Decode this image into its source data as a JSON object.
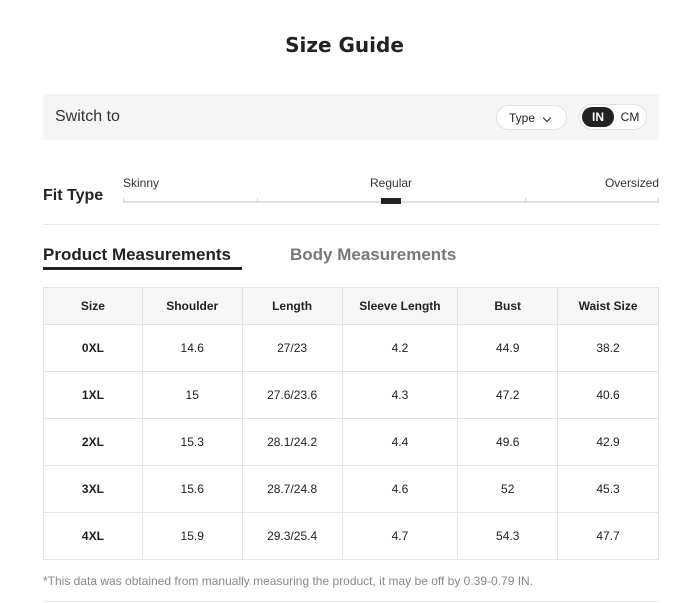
{
  "title": "Size Guide",
  "switch_bar": {
    "label": "Switch to",
    "type_dropdown": "Type",
    "units": {
      "in": "IN",
      "cm": "CM",
      "selected": "IN"
    }
  },
  "fit_type": {
    "label": "Fit Type",
    "options": [
      "Skinny",
      "Regular",
      "Oversized"
    ],
    "selected": "Regular"
  },
  "tabs": {
    "product": "Product Measurements",
    "body": "Body Measurements",
    "active": "Product Measurements"
  },
  "table": {
    "headers": [
      "Size",
      "Shoulder",
      "Length",
      "Sleeve Length",
      "Bust",
      "Waist Size"
    ],
    "rows": [
      [
        "0XL",
        "14.6",
        "27/23",
        "4.2",
        "44.9",
        "38.2"
      ],
      [
        "1XL",
        "15",
        "27.6/23.6",
        "4.3",
        "47.2",
        "40.6"
      ],
      [
        "2XL",
        "15.3",
        "28.1/24.2",
        "4.4",
        "49.6",
        "42.9"
      ],
      [
        "3XL",
        "15.6",
        "28.7/24.8",
        "4.6",
        "52",
        "45.3"
      ],
      [
        "4XL",
        "15.9",
        "29.3/25.4",
        "4.7",
        "54.3",
        "47.7"
      ]
    ]
  },
  "note": "*This data was obtained from manually measuring the product, it may be off by 0.39-0.79 IN."
}
